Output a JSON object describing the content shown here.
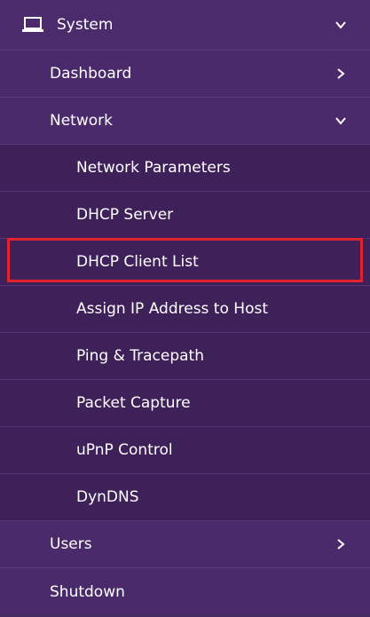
{
  "menu": {
    "system": {
      "label": "System",
      "icon": "laptop-icon",
      "chevron": "chevron-down-icon"
    },
    "dashboard": {
      "label": "Dashboard",
      "chevron": "chevron-right-icon"
    },
    "network": {
      "label": "Network",
      "chevron": "chevron-down-icon"
    },
    "network_items": [
      {
        "label": "Network Parameters"
      },
      {
        "label": "DHCP Server"
      },
      {
        "label": "DHCP Client List",
        "highlighted": true
      },
      {
        "label": "Assign IP Address to Host"
      },
      {
        "label": "Ping & Tracepath"
      },
      {
        "label": "Packet Capture"
      },
      {
        "label": "uPnP Control"
      },
      {
        "label": "DynDNS"
      }
    ],
    "users": {
      "label": "Users",
      "chevron": "chevron-right-icon"
    },
    "shutdown": {
      "label": "Shutdown"
    }
  },
  "colors": {
    "highlight_border": "#e0232f",
    "sidebar_bg": "#452965",
    "submenu_bg": "#3f2159",
    "text": "#ffffff"
  }
}
